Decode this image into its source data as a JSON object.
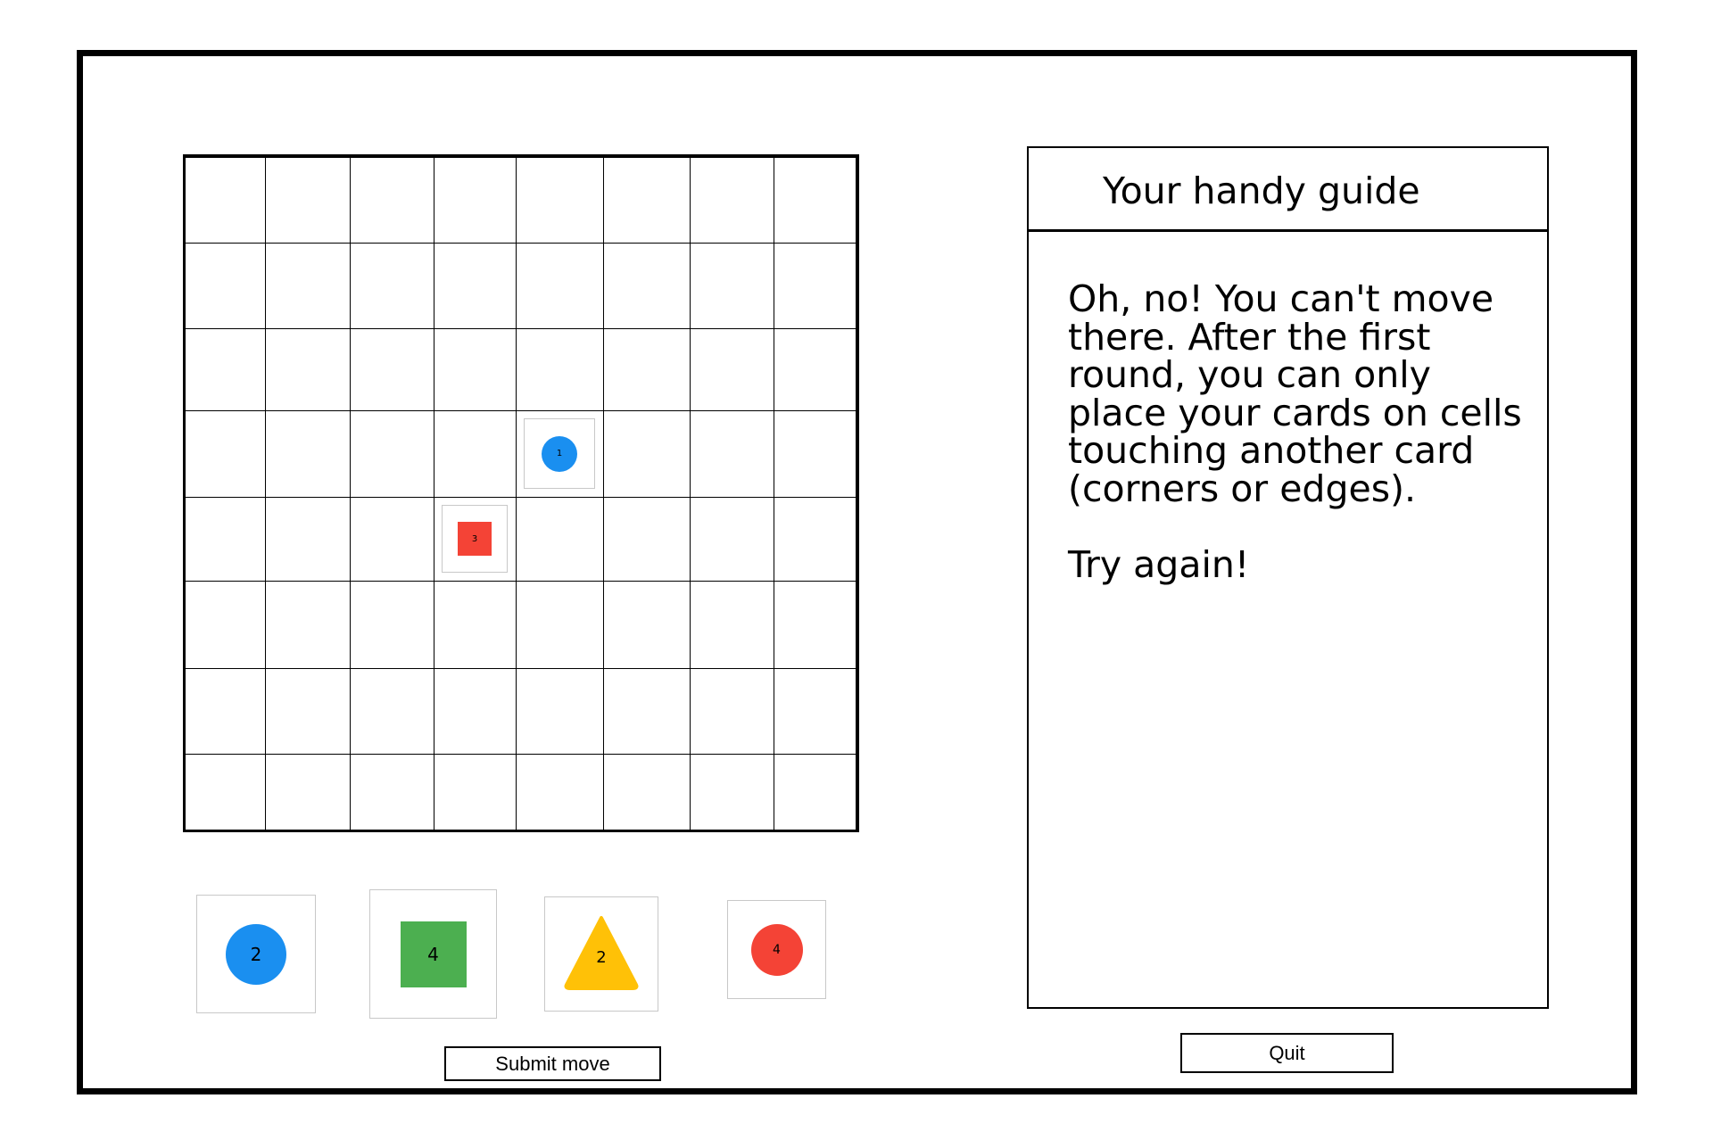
{
  "board": {
    "rows": 8,
    "cols": 8,
    "placed_cards": [
      {
        "row": 3,
        "col": 4,
        "shape": "circle",
        "color": "#1a8ff0",
        "number": "1"
      },
      {
        "row": 4,
        "col": 3,
        "shape": "square",
        "color": "#f44336",
        "number": "3"
      }
    ]
  },
  "hand": {
    "cards": [
      {
        "shape": "circle",
        "color": "#1a8ff0",
        "number": "2"
      },
      {
        "shape": "square",
        "color": "#4caf50",
        "number": "4"
      },
      {
        "shape": "triangle",
        "color": "#ffc107",
        "number": "2"
      },
      {
        "shape": "circle",
        "color": "#f44336",
        "number": "4"
      }
    ]
  },
  "guide": {
    "title": "Your handy guide",
    "message": "Oh, no! You can't move there. After the first round, you can only place your cards on cells touching another card (corners or edges).\n\nTry again!"
  },
  "buttons": {
    "submit_label": "Submit move",
    "quit_label": "Quit"
  }
}
